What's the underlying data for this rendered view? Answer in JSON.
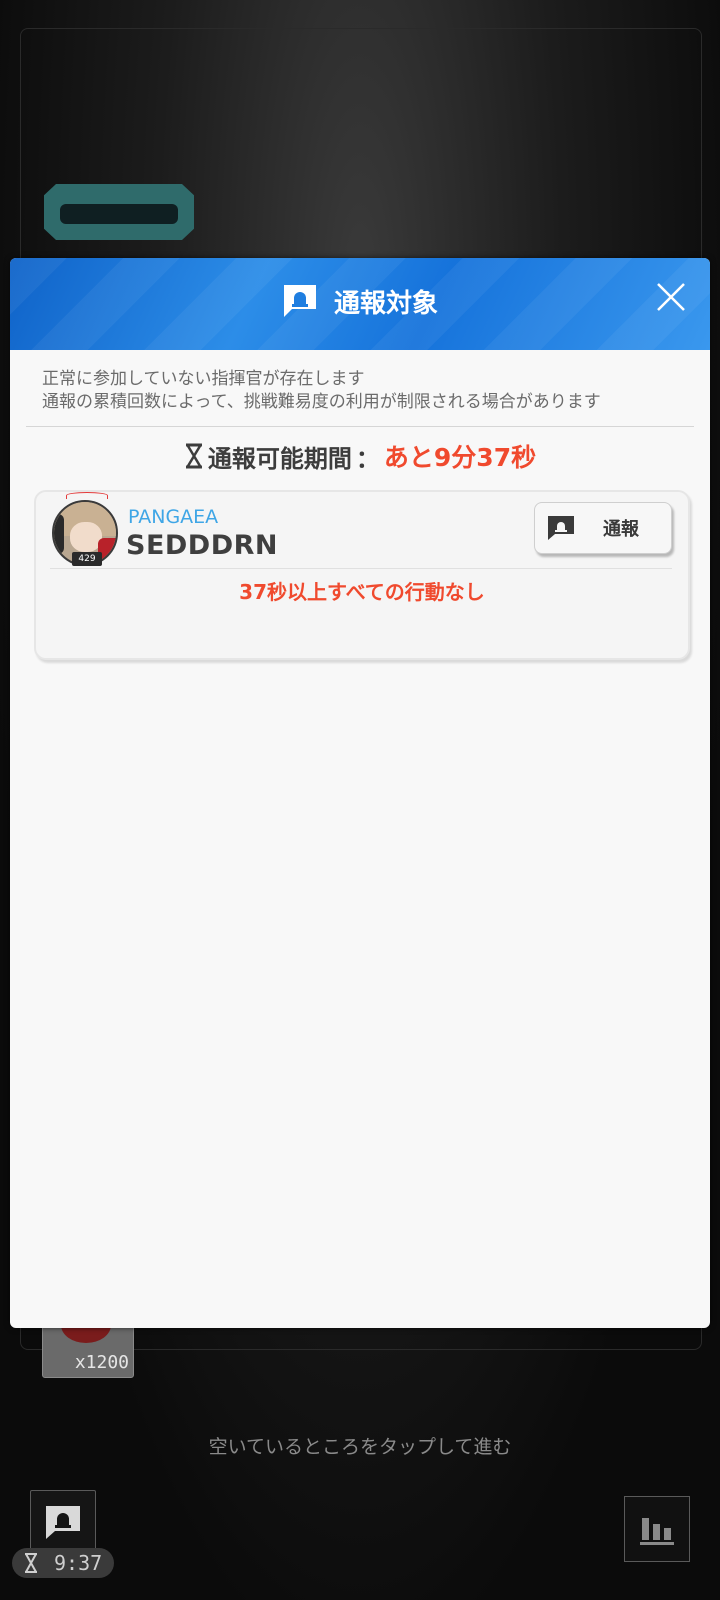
{
  "background": {
    "item_quantity": "x1200",
    "tap_hint": "空いているところをタップして進む",
    "report_timer": "9:37",
    "icons": {
      "hourglass": "hourglass-icon",
      "report": "report-bell-icon",
      "stats": "bar-chart-icon"
    }
  },
  "modal": {
    "title": "通報対象",
    "description_line1": "正常に参加していない指揮官が存在します",
    "description_line2": "通報の累積回数によって、挑戦難易度の利用が制限される場合があります",
    "period_label": "通報可能期間",
    "period_separator": "：",
    "period_value": "あと9分37秒",
    "players": [
      {
        "guild": "PANGAEA",
        "name": "SEDDDRN",
        "level": "429",
        "report_label": "通報",
        "reason": "37秒以上すべての行動なし"
      }
    ]
  },
  "colors": {
    "header_blue": "#1f7ee0",
    "alert_red": "#f04a2e",
    "guild_blue": "#3fa6e6",
    "panel_bg": "#f8f8f8"
  }
}
